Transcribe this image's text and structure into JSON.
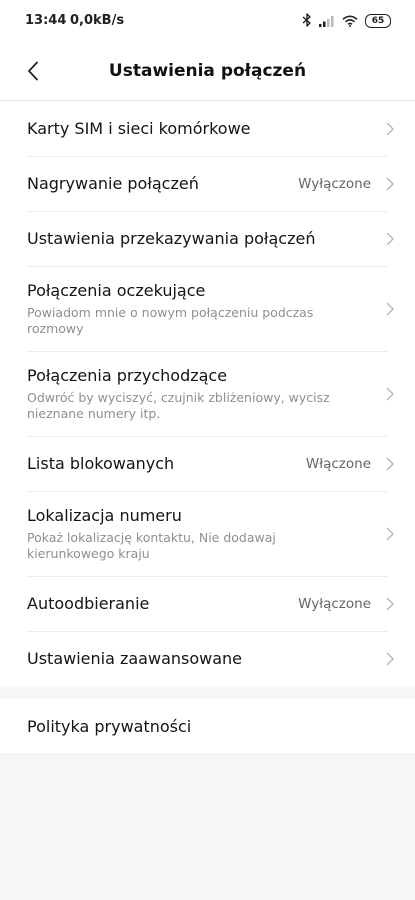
{
  "status_bar": {
    "time": "13:44",
    "speed": "0,0kB/s",
    "battery": "65",
    "icons": [
      "bluetooth-icon",
      "signal-icon",
      "wifi-icon",
      "battery-icon"
    ]
  },
  "header": {
    "title": "Ustawienia połączeń",
    "back_icon": "back-arrow-icon"
  },
  "items": [
    {
      "title": "Karty SIM i sieci komórkowe",
      "subtitle": "",
      "value": ""
    },
    {
      "title": "Nagrywanie połączeń",
      "subtitle": "",
      "value": "Wyłączone"
    },
    {
      "title": "Ustawienia przekazywania połączeń",
      "subtitle": "",
      "value": ""
    },
    {
      "title": "Połączenia oczekujące",
      "subtitle": "Powiadom mnie o nowym połączeniu podczas rozmowy",
      "value": ""
    },
    {
      "title": "Połączenia przychodzące",
      "subtitle": "Odwróć by wyciszyć, czujnik zbliżeniowy, wycisz nieznane numery itp.",
      "value": ""
    },
    {
      "title": "Lista blokowanych",
      "subtitle": "",
      "value": "Włączone"
    },
    {
      "title": "Lokalizacja numeru",
      "subtitle": "Pokaż lokalizację kontaktu, Nie dodawaj kierunkowego kraju",
      "value": ""
    },
    {
      "title": "Autoodbieranie",
      "subtitle": "",
      "value": "Wyłączone"
    },
    {
      "title": "Ustawienia zaawansowane",
      "subtitle": "",
      "value": ""
    }
  ],
  "footer_item": {
    "title": "Polityka prywatności"
  },
  "colors": {
    "background": "#f7f7f7",
    "surface": "#ffffff",
    "text_primary": "#141414",
    "text_secondary": "#8f8f8f",
    "divider": "#ececec"
  }
}
